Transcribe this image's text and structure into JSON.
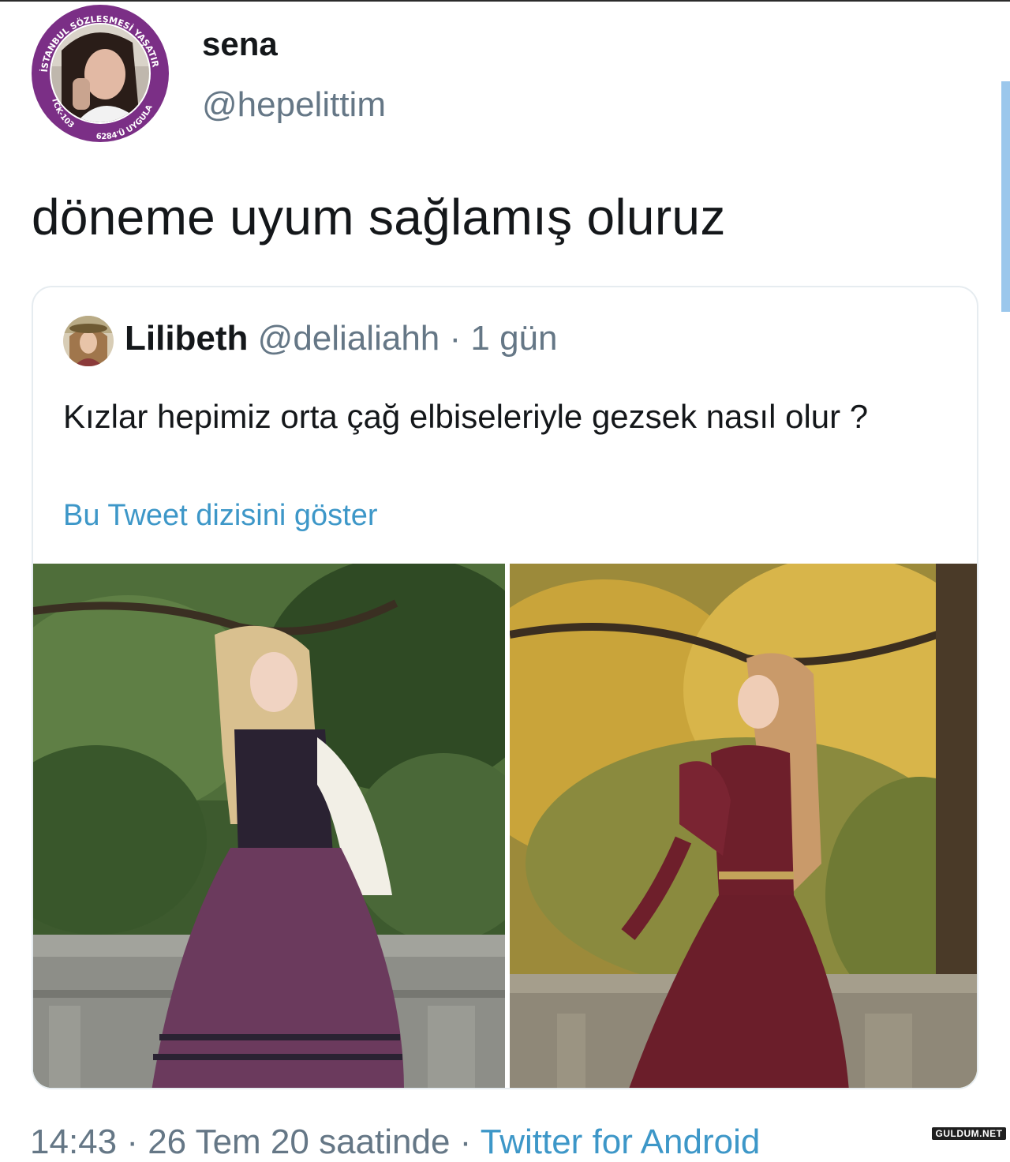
{
  "tweet": {
    "author": {
      "display_name": "sena",
      "handle": "@hepelittim",
      "avatar": {
        "icon": "profile-avatar-with-badge-ring",
        "ring_text_top": "İSTANBUL SÖZLEŞMESİ YAŞATIR",
        "ring_text_left": "TCK-103",
        "ring_text_bottom": "6284'Ü UYGULA",
        "ring_color": "#7b2f86"
      }
    },
    "text": "döneme uyum sağlamış oluruz",
    "quoted": {
      "display_name": "Lilibeth",
      "handle": "@delialiahh",
      "separator": "·",
      "time": "1 gün",
      "avatar_icon": "profile-avatar",
      "text": "Kızlar hepimiz orta çağ elbiseleriyle gezsek nasıl olur ?",
      "show_thread": "Bu Tweet dizisini göster",
      "photos": [
        {
          "icon": "photo-woman-purple-medieval-dress"
        },
        {
          "icon": "photo-woman-burgundy-medieval-dress"
        }
      ]
    },
    "footer": {
      "time": "14:43 · 26 Tem 20 saatinde · ",
      "client": "Twitter for Android"
    }
  },
  "watermark": "GULDUM.NET",
  "colors": {
    "text": "#14171a",
    "secondary": "#657786",
    "link": "#3d97c8",
    "border": "#e6ecf0"
  }
}
